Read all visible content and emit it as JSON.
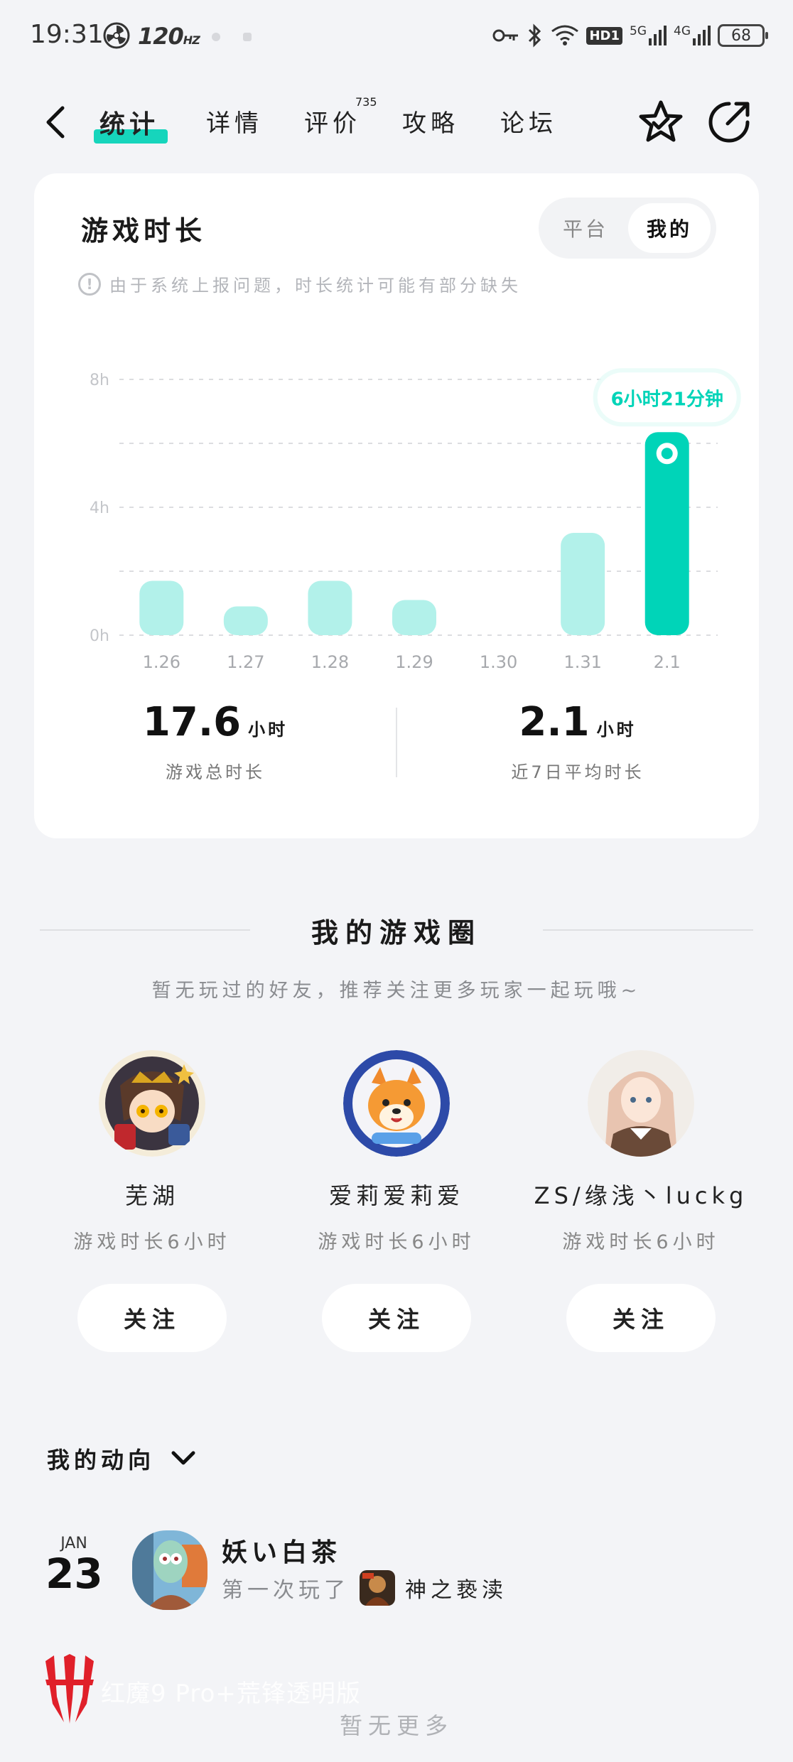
{
  "status_bar": {
    "time": "19:31",
    "refresh_rate": "120",
    "refresh_unit": "HZ",
    "hd_badge": "HD1",
    "net1": "5G",
    "net2": "4G",
    "battery": "68",
    "icons": [
      "fan-icon",
      "key-icon",
      "bluetooth-icon",
      "wifi-icon",
      "signal-icon",
      "battery-icon"
    ]
  },
  "nav": {
    "tabs": [
      {
        "label": "统计",
        "active": true
      },
      {
        "label": "详情"
      },
      {
        "label": "评价",
        "badge": "735"
      },
      {
        "label": "攻略"
      },
      {
        "label": "论坛"
      }
    ],
    "accent": "#16d5bc",
    "icons": [
      "back-icon",
      "favorite-star-icon",
      "share-icon"
    ]
  },
  "game_time": {
    "title": "游戏时长",
    "toggle": {
      "left": "平台",
      "right": "我的",
      "selected": "我的"
    },
    "notice": "由于系统上报问题，时长统计可能有部分缺失",
    "notice_icon": "!",
    "tooltip": "6小时21分钟",
    "total_value": "17.6",
    "total_unit": "小时",
    "total_label": "游戏总时长",
    "avg_value": "2.1",
    "avg_unit": "小时",
    "avg_label": "近7日平均时长"
  },
  "chart_data": {
    "type": "bar",
    "categories": [
      "1.26",
      "1.27",
      "1.28",
      "1.29",
      "1.30",
      "1.31",
      "2.1"
    ],
    "values": [
      1.7,
      0.9,
      1.7,
      1.1,
      0,
      3.2,
      6.35
    ],
    "y_ticks": [
      "0h",
      "4h",
      "8h"
    ],
    "ylim": [
      0,
      8
    ],
    "highlight_index": 6,
    "grid": true,
    "colors": {
      "bar": "#b2f1ea",
      "highlight": "#00d4b8",
      "grid": "#dcdde0"
    }
  },
  "circle": {
    "title": "我的游戏圈",
    "subtitle": "暂无玩过的好友，推荐关注更多玩家一起玩哦~",
    "friends": [
      {
        "name": "芜湖",
        "time": "游戏时长6小时",
        "button": "关注"
      },
      {
        "name": "爱莉爱莉爱",
        "time": "游戏时长6小时",
        "button": "关注"
      },
      {
        "name": "ZS/缘浅丶luckg",
        "time": "游戏时长6小时",
        "button": "关注"
      }
    ]
  },
  "activity": {
    "title": "我的动向",
    "date_month": "JAN",
    "date_day": "23",
    "user": "妖い白茶",
    "desc": "第一次玩了",
    "game": "神之亵渎"
  },
  "footer": {
    "watermark": "红魔9 Pro+荒锋透明版",
    "no_more": "暂无更多"
  }
}
